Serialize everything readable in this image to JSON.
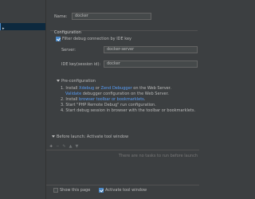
{
  "form": {
    "name_label": "Name:",
    "name_value": "docker"
  },
  "configuration": {
    "title": "Configuration",
    "filter_debug_label": "Filter debug connection by IDE key",
    "filter_debug_checked": true,
    "server_label": "Server:",
    "server_value": "docker-server",
    "ide_key_label": "IDE key(session id):",
    "ide_key_value": "docker"
  },
  "preconfiguration": {
    "title": "Pre-configuration",
    "step1_prefix": "1. Install ",
    "step1_link1": "Xdebug",
    "step1_or": " or ",
    "step1_link2": "Zend Debugger",
    "step1_suffix": " on the Web Server.",
    "step1b_link": "Validate",
    "step1b_suffix": " debugger configuration on the Web Server.",
    "step2_prefix": "2. Install ",
    "step2_link": "browser toolbar or bookmarklets",
    "step2_suffix": ".",
    "step3": "3. Start \"PHP Remote Debug\" run configuration.",
    "step4": "4. Start debug session in browser with the toolbar or bookmarklets."
  },
  "before_launch": {
    "title": "Before launch: Activate tool window",
    "toolbar_icons": [
      "add-icon",
      "remove-icon",
      "edit-icon",
      "move-up-icon",
      "move-down-icon"
    ],
    "toolbar_glyphs": [
      "+",
      "−",
      "✎",
      "▲",
      "▼"
    ],
    "empty_text": "There are no tasks to run before launch"
  },
  "footer": {
    "show_page_label": "Show this page",
    "show_page_checked": false,
    "activate_tool_window_label": "Activate tool window",
    "activate_tool_window_checked": true
  },
  "sidebar": {
    "selected_glyph": "▸"
  },
  "colors": {
    "background": "#3c3f41",
    "link": "#589df6",
    "accent": "#4a88c7",
    "selection": "#0d293e"
  }
}
